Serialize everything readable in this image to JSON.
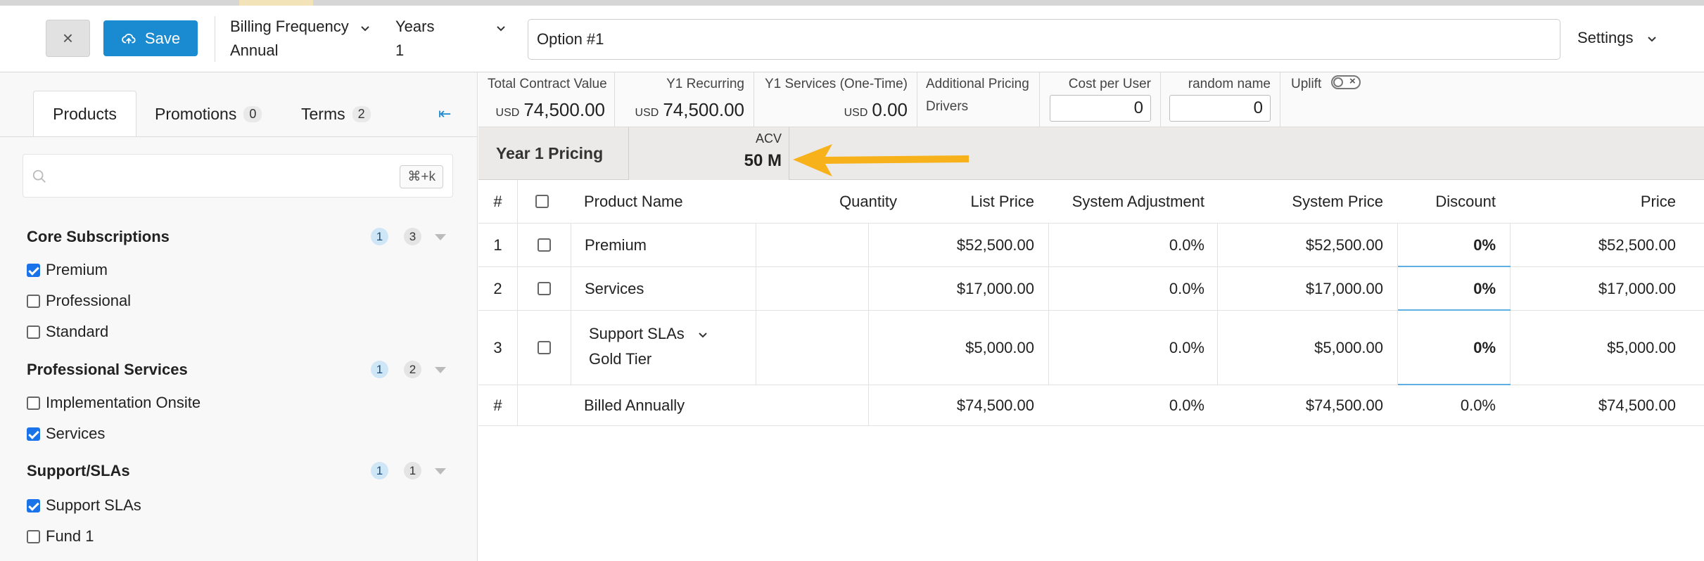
{
  "header": {
    "close_label": "×",
    "save_label": "Save",
    "billing_frequency_label": "Billing Frequency",
    "billing_frequency_value": "Annual",
    "years_label": "Years",
    "years_value": "1",
    "option_name": "Option #1",
    "settings_label": "Settings"
  },
  "left": {
    "tabs": [
      {
        "label": "Products",
        "badge": ""
      },
      {
        "label": "Promotions",
        "badge": "0"
      },
      {
        "label": "Terms",
        "badge": "2"
      }
    ],
    "collapse_glyph": "⇤",
    "search": {
      "placeholder": "",
      "shortcut": "⌘+k"
    },
    "groups": [
      {
        "title": "Core Subscriptions",
        "selected": "1",
        "total": "3",
        "items": [
          {
            "label": "Premium",
            "checked": true
          },
          {
            "label": "Professional",
            "checked": false
          },
          {
            "label": "Standard",
            "checked": false
          }
        ]
      },
      {
        "title": "Professional Services",
        "selected": "1",
        "total": "2",
        "items": [
          {
            "label": "Implementation Onsite",
            "checked": false
          },
          {
            "label": "Services",
            "checked": true
          }
        ]
      },
      {
        "title": "Support/SLAs",
        "selected": "1",
        "total": "1",
        "items": [
          {
            "label": "Support SLAs",
            "checked": true
          },
          {
            "label": "Fund 1",
            "checked": false
          }
        ]
      }
    ]
  },
  "metrics": {
    "tcv": {
      "label": "Total Contract Value",
      "currency": "USD",
      "value": "74,500.00"
    },
    "y1_recurring": {
      "label": "Y1 Recurring",
      "currency": "USD",
      "value": "74,500.00"
    },
    "y1_services": {
      "label": "Y1 Services (One-Time)",
      "currency": "USD",
      "value": "0.00"
    },
    "additional_drivers": {
      "label_line1": "Additional Pricing",
      "label_line2": "Drivers"
    },
    "cost_per_user": {
      "label": "Cost per User",
      "value": "0"
    },
    "random_name": {
      "label": "random name",
      "value": "0"
    },
    "uplift": {
      "label": "Uplift",
      "enabled": false
    }
  },
  "pricing": {
    "year_label": "Year 1 Pricing",
    "acv_label": "ACV",
    "acv_value": "50 M"
  },
  "table": {
    "headers": {
      "num": "#",
      "product": "Product Name",
      "quantity": "Quantity",
      "list_price": "List Price",
      "system_adjustment": "System Adjustment",
      "system_price": "System Price",
      "discount": "Discount",
      "price": "Price"
    },
    "rows": [
      {
        "num": "1",
        "product": "Premium",
        "quantity": "",
        "list_price": "$52,500.00",
        "system_adjustment": "0.0%",
        "system_price": "$52,500.00",
        "discount": "0%",
        "price": "$52,500.00"
      },
      {
        "num": "2",
        "product": "Services",
        "quantity": "",
        "list_price": "$17,000.00",
        "system_adjustment": "0.0%",
        "system_price": "$17,000.00",
        "discount": "0%",
        "price": "$17,000.00"
      },
      {
        "num": "3",
        "product": "Support SLAs",
        "product_tier": "Gold Tier",
        "quantity": "",
        "list_price": "$5,000.00",
        "system_adjustment": "0.0%",
        "system_price": "$5,000.00",
        "discount": "0%",
        "price": "$5,000.00"
      }
    ],
    "footer": {
      "num": "#",
      "product": "Billed Annually",
      "list_price": "$74,500.00",
      "system_adjustment": "0.0%",
      "system_price": "$74,500.00",
      "discount": "0.0%",
      "price": "$74,500.00"
    }
  },
  "colors": {
    "accent": "#1a8ad1",
    "arrow": "#f7b21b",
    "checkbox": "#1a73e8"
  }
}
